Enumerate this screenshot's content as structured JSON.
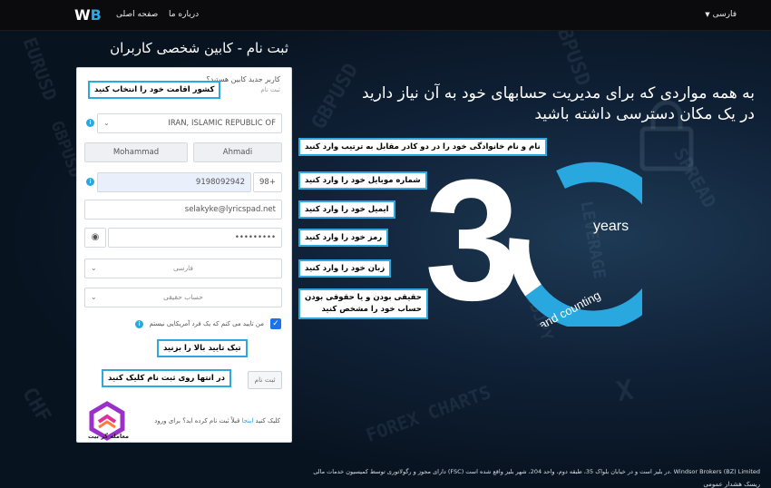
{
  "nav": {
    "logo_text": "W",
    "logo_text_b": "B",
    "home": "صفحه اصلی",
    "about": "درباره ما",
    "language": "فارسی"
  },
  "page": {
    "title": "ثبت نام - کابین شخصی کاربران"
  },
  "form": {
    "header_question": "کاربر جدید کابین هستید؟",
    "header_link": "ثبت نام",
    "country": "IRAN, ISLAMIC REPUBLIC OF",
    "first_name": "Mohammad",
    "last_name": "Ahmadi",
    "phone_code": "98+",
    "phone": "9198092942",
    "email": "selakyke@lyricspad.net",
    "password": "•••••••••",
    "language": "فارسی",
    "account_type": "حساب حقیقی",
    "not_american": "من تایید می کنم که یک فرد آمریکایی نیستم",
    "submit": "ثبت نام",
    "already_registered": "قبلاً ثبت نام کرده اید؟ برای ورود",
    "here": "اینجا",
    "click": "کلیک کنید",
    "brand_caption": "معامله گر بیت"
  },
  "annotations": {
    "country": "کشور اقامت خود را انتخاب کنید",
    "name": "نام و نام خانوادگی خود را در دو کادر مقابل به ترتیب وارد کنید",
    "mobile": "شماره موبایل خود را وارد کنید",
    "email": "ایمیل خود را وارد کنید",
    "password": "رمز خود را وارد کنید",
    "language": "زبان خود را وارد کنید",
    "account_line1": "حقیقی بودن و یا حقوقی بودن",
    "account_line2": "حساب خود را مشخص کنید",
    "check": "تیک تایید بالا را بزنید",
    "submit": "در انتها روی ثبت نام کلیک کنید"
  },
  "hero": {
    "line1": "به همه مواردی که برای مدیریت حسابهای خود به آن نیاز دارید",
    "line2": "در یک مکان دسترسی داشته باشید",
    "big_number": "30",
    "years": "years",
    "counting": "and counting"
  },
  "footer": {
    "company": "Windsor Brokers (BZ) Limited",
    "legal": "دارای مجوز و رگولاتوری توسط کمیسیون خدمات مالی (FSC) در بلیز است و در خیابان بلواک 35، طبقه دوم، واحد 204، شهر بلیز واقع شده است.",
    "line2": "ریسک هشدار عمومی"
  },
  "colors": {
    "accent": "#29a8e0",
    "annotation_border": "#2ea8e0",
    "background": "#0a1420"
  }
}
